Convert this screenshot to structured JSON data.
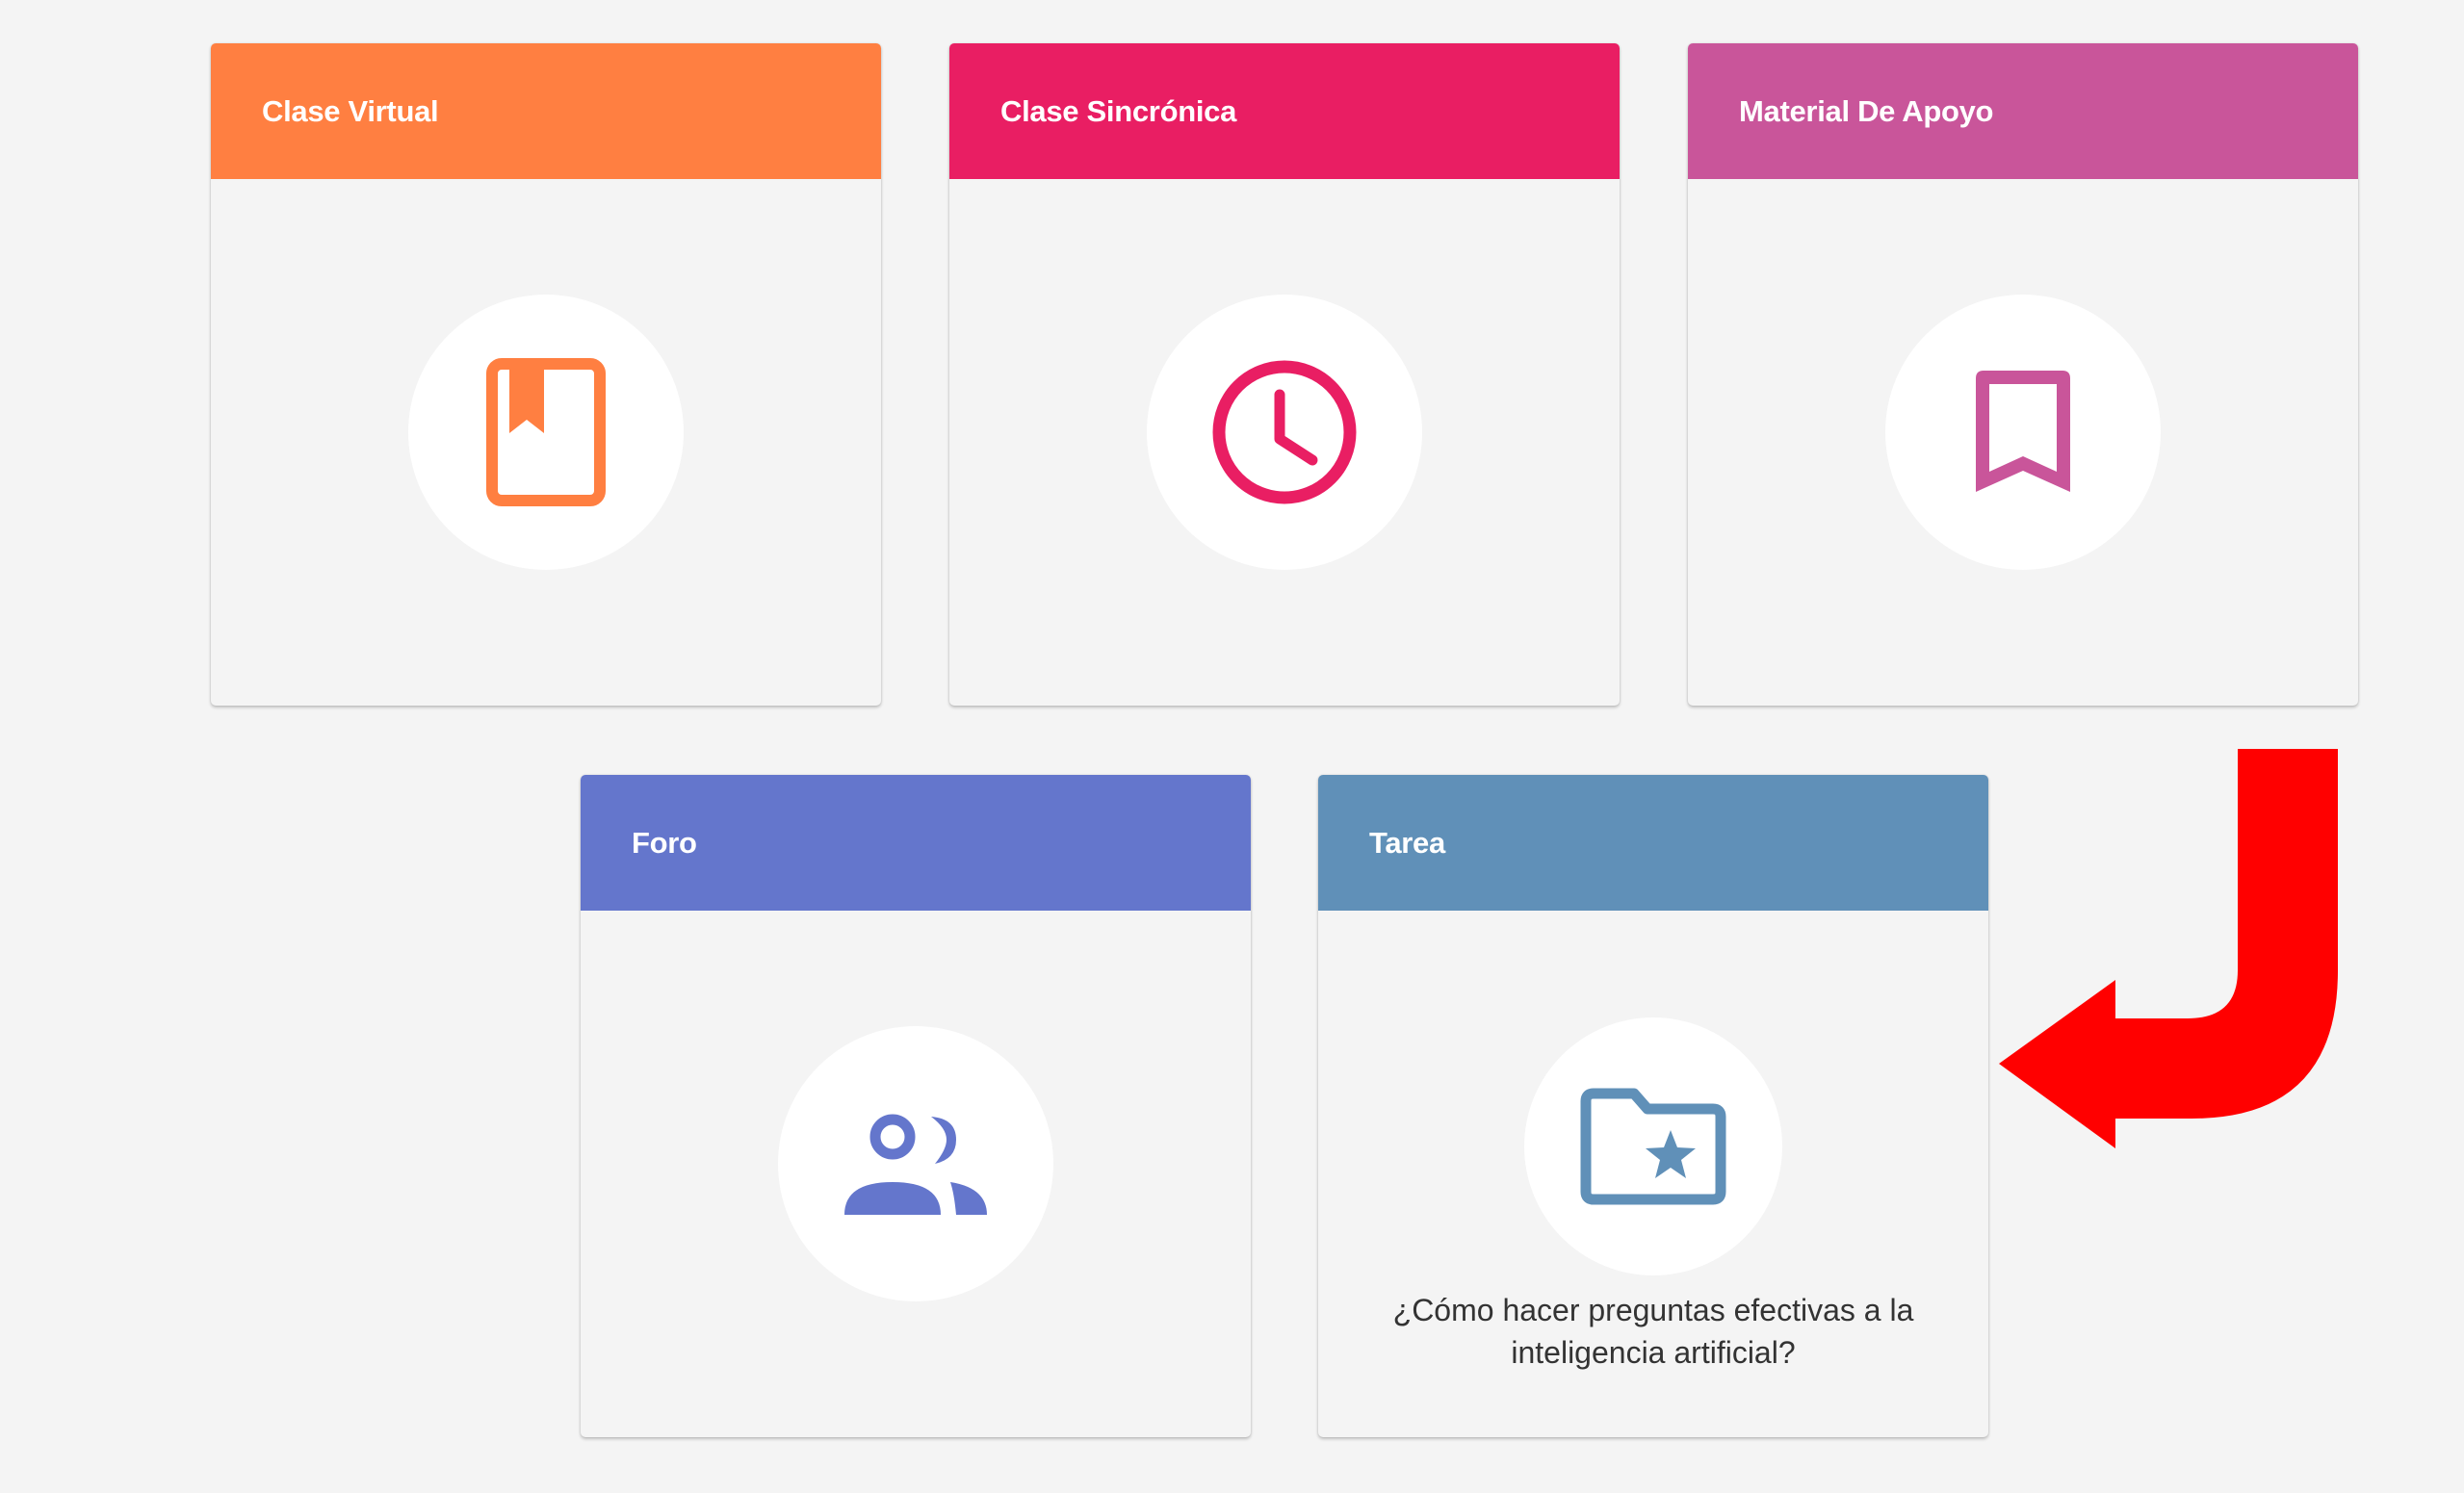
{
  "cards": [
    {
      "title": "Clase Virtual",
      "color": "#ff7f41",
      "icon": "book-icon"
    },
    {
      "title": "Clase Sincrónica",
      "color": "#e91e63",
      "icon": "clock-icon"
    },
    {
      "title": "Material De Apoyo",
      "color": "#c9559a",
      "icon": "bookmark-icon"
    },
    {
      "title": "Foro",
      "color": "#6476cc",
      "icon": "people-icon"
    },
    {
      "title": "Tarea",
      "color": "#6090b8",
      "icon": "folder-star-icon",
      "caption": "¿Cómo hacer preguntas efectivas a la inteligencia artificial?"
    }
  ],
  "annotation": {
    "icon": "curved-arrow-left-icon",
    "color": "#ff0000"
  }
}
